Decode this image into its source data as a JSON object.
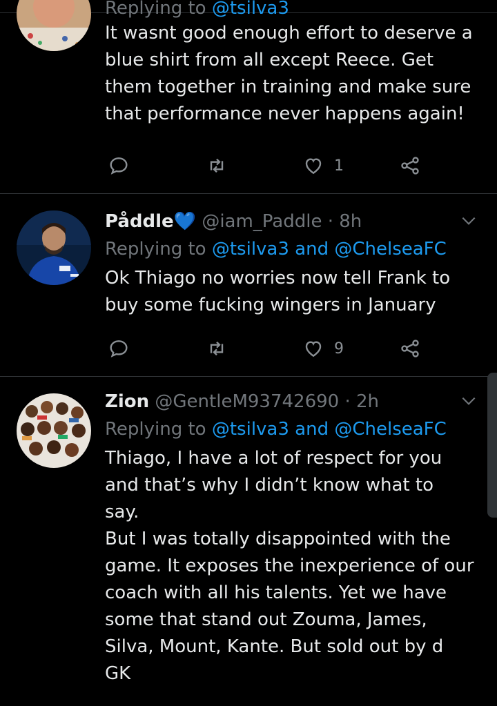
{
  "tweets": [
    {
      "reply_to": "Replying to @tsilva3",
      "text": "It wasnt good enough effort to deserve a\nblue shirt from all except Reece. Get\nthem together in training and make sure\nthat performance never happens again!",
      "reply_count": "",
      "retweet_count": "",
      "like_count": "1"
    },
    {
      "display_name": "Påddle💙",
      "handle": "@iam_Paddle",
      "time": "· 8h",
      "replying_label": "Replying to",
      "reply_to": "@tsilva3 and @ChelseaFC",
      "text": "Ok Thiago no worries now tell Frank to\nbuy some fucking wingers in January",
      "like_count": "9"
    },
    {
      "display_name": "Zion",
      "handle": "@GentleM93742690",
      "time": "· 2h",
      "replying_label": "Replying to",
      "reply_to": "@tsilva3 and @ChelseaFC",
      "text": "Thiago, I have a lot of respect for you\nand that’s why I didn’t know what to\nsay.\nBut I was totally disappointed with the\ngame. It exposes the inexperience of our\ncoach with all his talents. Yet we have\nsome that stand out Zouma, James,\nSilva, Mount, Kante. But sold out by d\nGK"
    }
  ],
  "icons": {
    "reply": "reply-icon",
    "retweet": "retweet-icon",
    "like": "heart-icon",
    "share": "share-icon",
    "more": "chevron-down-icon"
  },
  "colors": {
    "background": "#000000",
    "text": "#e7e9ea",
    "muted": "#71767b",
    "mention": "#1d9bf0",
    "heart_emoji": "#3b9cf5"
  }
}
